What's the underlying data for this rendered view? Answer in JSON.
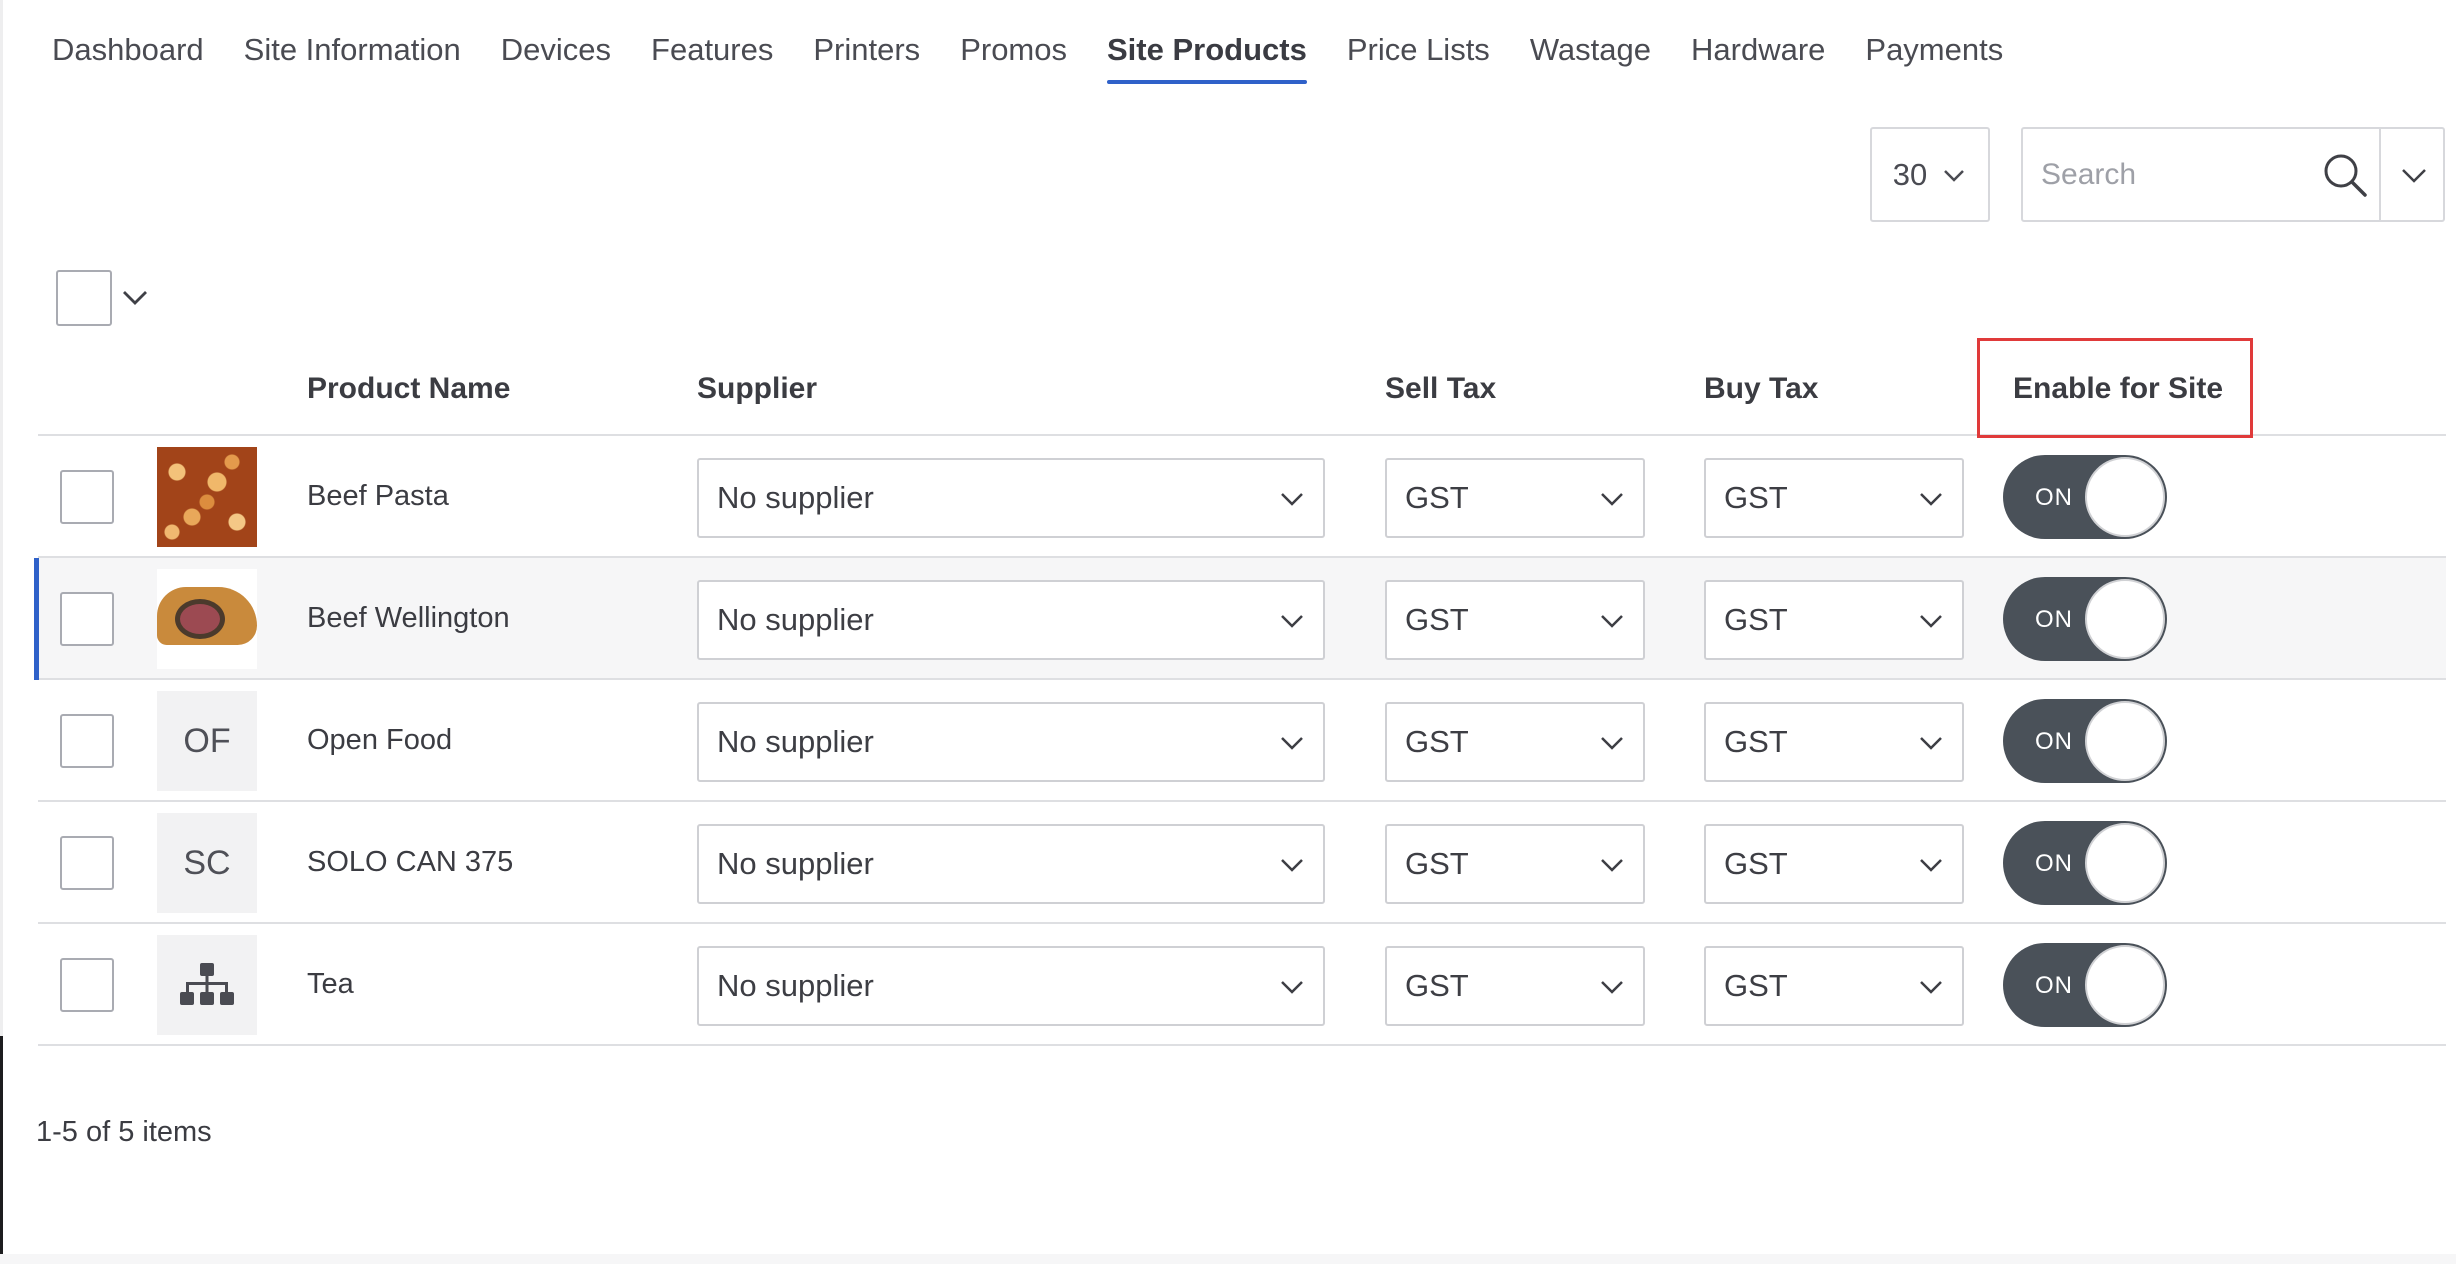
{
  "tabs": [
    {
      "label": "Dashboard"
    },
    {
      "label": "Site Information"
    },
    {
      "label": "Devices"
    },
    {
      "label": "Features"
    },
    {
      "label": "Printers"
    },
    {
      "label": "Promos"
    },
    {
      "label": "Site Products",
      "active": true
    },
    {
      "label": "Price Lists"
    },
    {
      "label": "Wastage"
    },
    {
      "label": "Hardware"
    },
    {
      "label": "Payments"
    }
  ],
  "toolbar": {
    "page_size": "30",
    "search_placeholder": "Search"
  },
  "table": {
    "headers": {
      "product_name": "Product Name",
      "supplier": "Supplier",
      "sell_tax": "Sell Tax",
      "buy_tax": "Buy Tax",
      "enable_for_site": "Enable for Site"
    },
    "rows": [
      {
        "name": "Beef Pasta",
        "thumb": "image",
        "supplier": "No supplier",
        "sell_tax": "GST",
        "buy_tax": "GST",
        "enabled": "ON"
      },
      {
        "name": "Beef Wellington",
        "thumb": "image",
        "supplier": "No supplier",
        "sell_tax": "GST",
        "buy_tax": "GST",
        "enabled": "ON"
      },
      {
        "name": "Open Food",
        "thumb": "OF",
        "supplier": "No supplier",
        "sell_tax": "GST",
        "buy_tax": "GST",
        "enabled": "ON"
      },
      {
        "name": "SOLO CAN 375",
        "thumb": "SC",
        "supplier": "No supplier",
        "sell_tax": "GST",
        "buy_tax": "GST",
        "enabled": "ON"
      },
      {
        "name": "Tea",
        "thumb": "hierarchy-icon",
        "supplier": "No supplier",
        "sell_tax": "GST",
        "buy_tax": "GST",
        "enabled": "ON"
      }
    ]
  },
  "footer": {
    "count": "1-5 of 5 items"
  },
  "colors": {
    "accent": "#2f61c9",
    "toggle_on": "#4a5159",
    "highlight": "#e03a3a"
  }
}
